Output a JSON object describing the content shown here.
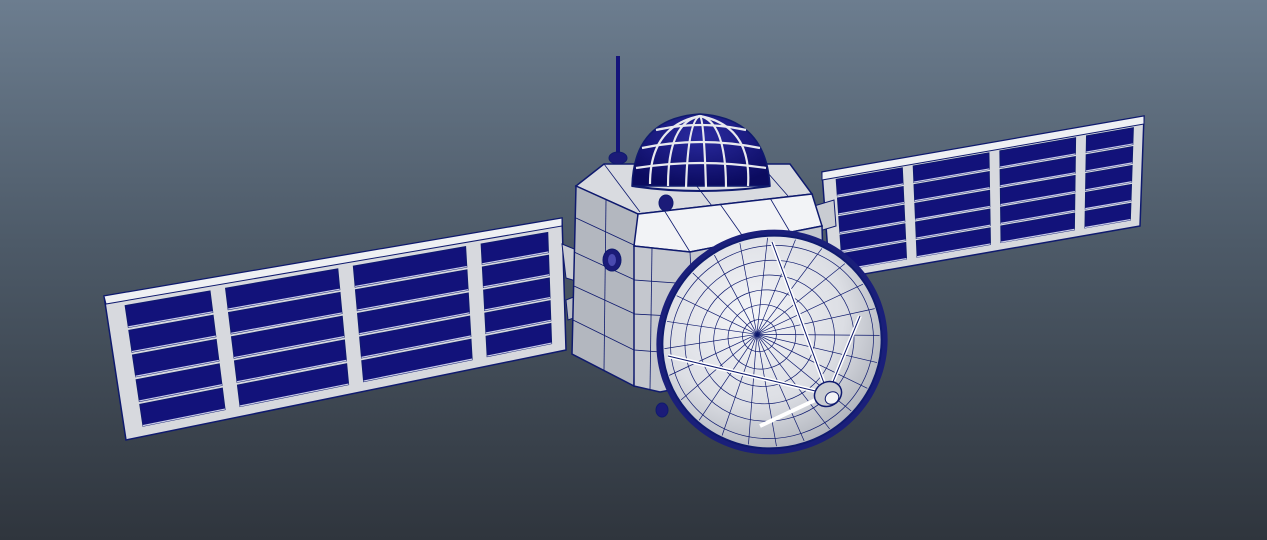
{
  "viewport": {
    "background_top": "#6c7d8f",
    "background_bottom": "#2f353d"
  },
  "model": {
    "kind": "satellite",
    "wire_color": "#0f1a6e",
    "panel_cell_color": "#12127a",
    "shell_color": "#d4d6da",
    "shell_shadow_color": "#9a9ea6",
    "panel_cell_rows": 5
  }
}
